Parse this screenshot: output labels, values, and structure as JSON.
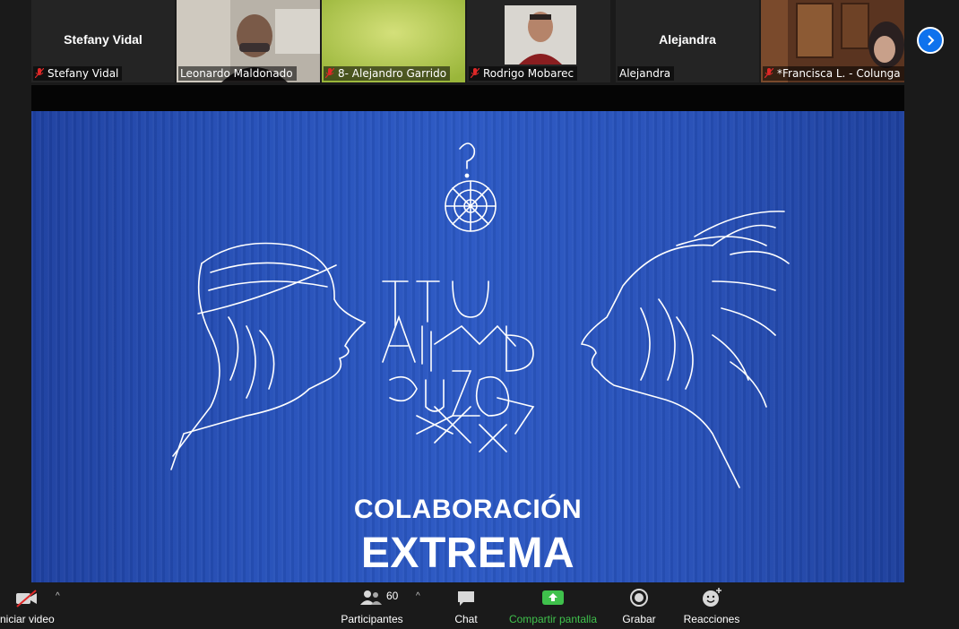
{
  "participants_strip": [
    {
      "center_name": "Stefany Vidal",
      "label": "Stefany Vidal",
      "muted": true,
      "type": "name"
    },
    {
      "label": "Leonardo Maldonado",
      "muted": false,
      "type": "video",
      "active": true
    },
    {
      "label": "8- Alejandro Garrido",
      "muted": true,
      "type": "video"
    },
    {
      "label": "Rodrigo Mobarec",
      "muted": true,
      "type": "video"
    },
    {
      "center_name": "Alejandra",
      "label": "Alejandra",
      "muted": false,
      "type": "name"
    },
    {
      "label": "*Francisca L. - Colunga",
      "muted": true,
      "type": "video"
    }
  ],
  "slide": {
    "title_line1": "COLABORACIÓN",
    "title_line2": "EXTREMA"
  },
  "toolbar": {
    "video_label": "niciar video",
    "participants_label": "Participantes",
    "participants_count": "60",
    "chat_label": "Chat",
    "share_label": "Compartir pantalla",
    "record_label": "Grabar",
    "reactions_label": "Reacciones"
  },
  "colors": {
    "accent": "#0e72ed",
    "share_green": "#3fc14c",
    "slide_blue": "#2b58c4",
    "muted_red": "#e02828"
  }
}
